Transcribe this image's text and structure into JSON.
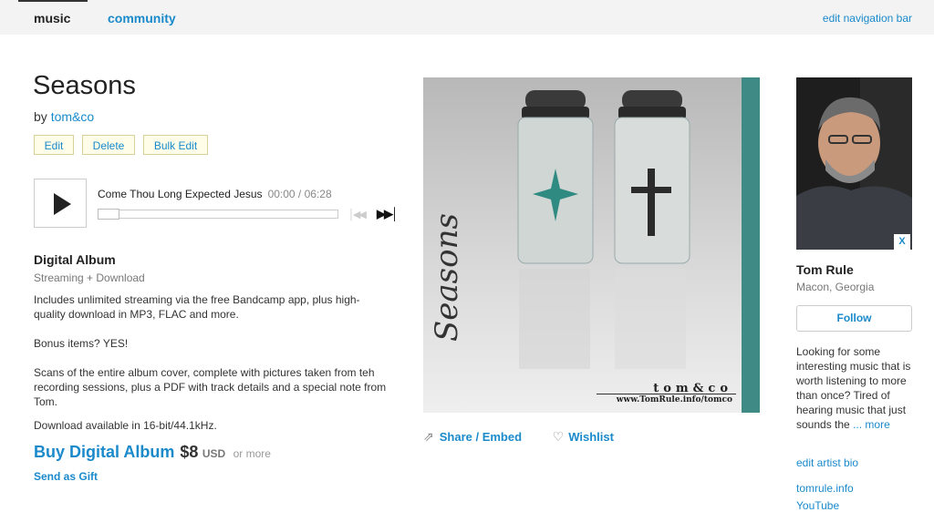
{
  "nav": {
    "tabs": [
      {
        "label": "music"
      },
      {
        "label": "community"
      }
    ],
    "edit_label": "edit navigation bar"
  },
  "album": {
    "title": "Seasons",
    "by_prefix": "by",
    "artist_link": "tom&co"
  },
  "admin": {
    "edit": "Edit",
    "delete": "Delete",
    "bulk_edit": "Bulk Edit"
  },
  "player": {
    "track_title": "Come Thou Long Expected Jesus",
    "time": "00:00 / 06:28",
    "progress": 0
  },
  "digital": {
    "heading": "Digital Album",
    "sub": "Streaming + Download",
    "desc1": "Includes unlimited streaming via the free Bandcamp app, plus high-quality download in MP3, FLAC and more.",
    "desc2": "Bonus items? YES!",
    "desc3": "Scans of the entire album cover, complete with pictures taken from teh recording sessions, plus a PDF with track details and a special note from Tom.",
    "desc4": "Download available in 16-bit/44.1kHz.",
    "buy_label": "Buy Digital Album",
    "price": "$8",
    "currency": "USD",
    "or_more": "or more",
    "gift": "Send as Gift"
  },
  "cover": {
    "script": "Seasons",
    "brand": "tom&co",
    "url": "www.TomRule.info/tomco"
  },
  "actions": {
    "share": "Share / Embed",
    "wishlist": "Wishlist"
  },
  "artist": {
    "close": "X",
    "name": "Tom Rule",
    "location": "Macon, Georgia",
    "follow": "Follow",
    "bio": "Looking for some interesting music that is worth listening to more than once? Tired of hearing music that just sounds the",
    "bio_more": "... more",
    "edit_bio": "edit artist bio",
    "links": [
      "tomrule.info",
      "YouTube"
    ]
  },
  "colors": {
    "link": "#1a8acb",
    "topbar": "#f3f3f3",
    "admin_bg": "#fffde8"
  }
}
